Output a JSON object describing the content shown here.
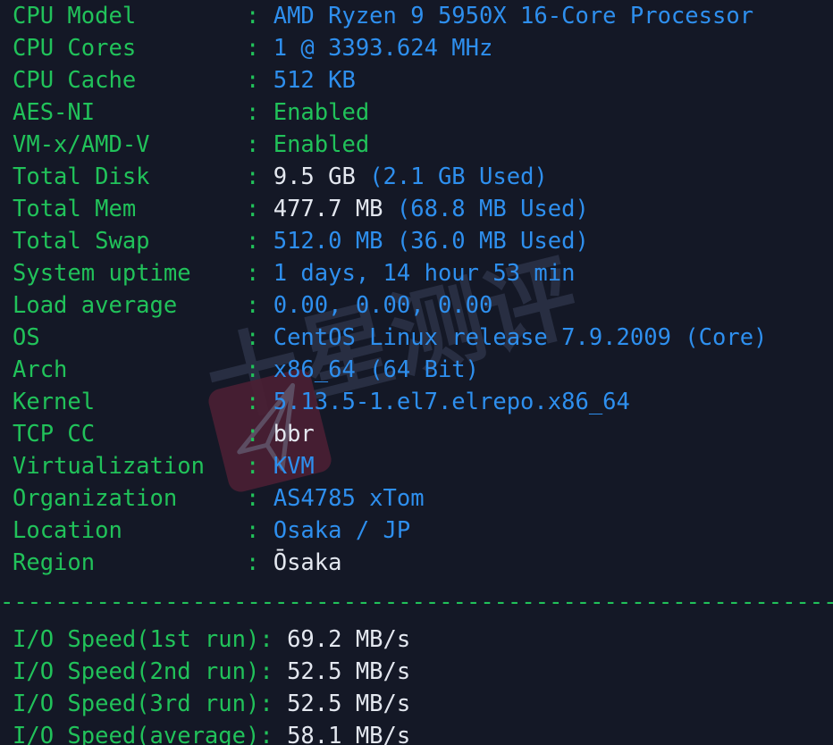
{
  "terminal": {
    "title": "system-info-benchmark-output",
    "background_color": "#141826",
    "label_color": "#21c25a",
    "value_blue": "#2e8fee",
    "value_white": "#e3e7ef",
    "separator": "----------------------------------------------------------------------",
    "colon": ":"
  },
  "watermark": {
    "text": "十星测评",
    "logo_color": "#4a1f33",
    "icon": "paper-plane-icon"
  },
  "system_info": [
    {
      "label": "CPU Model",
      "value": "AMD Ryzen 9 5950X 16-Core Processor",
      "color": "blue"
    },
    {
      "label": "CPU Cores",
      "value": "1 @ 3393.624 MHz",
      "color": "blue"
    },
    {
      "label": "CPU Cache",
      "value": "512 KB",
      "color": "blue"
    },
    {
      "label": "AES-NI",
      "value": "Enabled",
      "color": "green"
    },
    {
      "label": "VM-x/AMD-V",
      "value": "Enabled",
      "color": "green"
    },
    {
      "label": "Total Disk",
      "value": "9.5 GB",
      "extra": "(2.1 GB Used)",
      "color": "white",
      "extra_color": "blue"
    },
    {
      "label": "Total Mem",
      "value": "477.7 MB",
      "extra": "(68.8 MB Used)",
      "color": "white",
      "extra_color": "blue"
    },
    {
      "label": "Total Swap",
      "value": "512.0 MB (36.0 MB Used)",
      "color": "blue"
    },
    {
      "label": "System uptime",
      "value": "1 days, 14 hour 53 min",
      "color": "blue"
    },
    {
      "label": "Load average",
      "value": "0.00, 0.00, 0.00",
      "color": "blue"
    },
    {
      "label": "OS",
      "value": "CentOS Linux release 7.9.2009 (Core)",
      "color": "blue"
    },
    {
      "label": "Arch",
      "value": "x86_64 (64 Bit)",
      "color": "blue"
    },
    {
      "label": "Kernel",
      "value": "5.13.5-1.el7.elrepo.x86_64",
      "color": "blue"
    },
    {
      "label": "TCP CC",
      "value": "bbr",
      "color": "white"
    },
    {
      "label": "Virtualization",
      "value": "KVM",
      "color": "blue"
    },
    {
      "label": "Organization",
      "value": "AS4785 xTom",
      "color": "blue"
    },
    {
      "label": "Location",
      "value": "Osaka / JP",
      "color": "blue"
    },
    {
      "label": "Region",
      "value": "Ōsaka",
      "color": "white"
    }
  ],
  "io_speed": [
    {
      "label": "I/O Speed(1st run)",
      "value": "69.2 MB/s",
      "color": "white"
    },
    {
      "label": "I/O Speed(2nd run)",
      "value": "52.5 MB/s",
      "color": "white"
    },
    {
      "label": "I/O Speed(3rd run)",
      "value": "52.5 MB/s",
      "color": "white"
    },
    {
      "label": "I/O Speed(average)",
      "value": "58.1 MB/s",
      "color": "white"
    }
  ]
}
